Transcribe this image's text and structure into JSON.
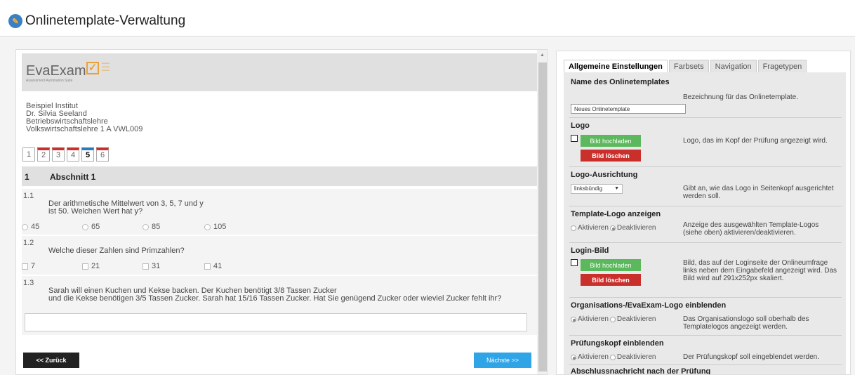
{
  "app": {
    "title": "Onlinetemplate-Verwaltung"
  },
  "preview": {
    "logo": {
      "text": "EvaExam",
      "subtitle": "Assessment Automation Suite"
    },
    "address": [
      "Beispiel Institut",
      "Dr. Silvia Seeland",
      "Betriebswirtschaftslehre",
      "Volkswirtschaftslehre 1 A VWL009"
    ],
    "page_tabs": [
      "1",
      "2",
      "3",
      "4",
      "5",
      "6"
    ],
    "section": {
      "number": "1",
      "title": "Abschnitt 1"
    },
    "questions": [
      {
        "number": "1.1",
        "text": [
          "Der arithmetische Mittelwert von 3, 5, 7 und y",
          "ist 50. Welchen Wert hat y?"
        ],
        "options": [
          "45",
          "65",
          "85",
          "105"
        ]
      },
      {
        "number": "1.2",
        "text": [
          "Welche dieser Zahlen sind Primzahlen?"
        ],
        "options": [
          "7",
          "21",
          "31",
          "41"
        ]
      },
      {
        "number": "1.3",
        "text": [
          "Sarah will einen Kuchen und Kekse backen. Der Kuchen benötigt 3/8 Tassen Zucker",
          "und die Kekse benötigen 3/5 Tassen Zucker. Sarah hat 15/16 Tassen Zucker. Hat Sie genügend Zucker oder wieviel Zucker fehlt ihr?"
        ]
      }
    ],
    "back_label": "<< Zurück",
    "next_label": "Nächste >>"
  },
  "settings": {
    "tabs": [
      "Allgemeine Einstellungen",
      "Farbsets",
      "Navigation",
      "Fragetypen"
    ],
    "name": {
      "heading": "Name des Onlinetemplates",
      "desc": "Bezeichnung für das Onlinetemplate.",
      "value": "Neues Onlinetemplate"
    },
    "logo": {
      "heading": "Logo",
      "upload": "Bild hochladen",
      "delete": "Bild löschen",
      "desc": "Logo, das im Kopf der Prüfung angezeigt wird."
    },
    "logo_align": {
      "heading": "Logo-Ausrichtung",
      "value": "linksbündig",
      "desc": "Gibt an, wie das Logo in Seitenkopf ausgerichtet werden soll."
    },
    "template_logo": {
      "heading": "Template-Logo anzeigen",
      "on": "Aktivieren",
      "off": "Deaktivieren",
      "desc": "Anzeige des ausgewählten Template-Logos (siehe oben) aktivieren/deaktivieren."
    },
    "login_image": {
      "heading": "Login-Bild",
      "upload": "Bild hochladen",
      "delete": "Bild löschen",
      "desc": "Bild, das auf der Loginseite der Onlineumfrage links neben dem Eingabefeld angezeigt wird. Das Bild wird auf 291x252px skaliert."
    },
    "org_logo": {
      "heading": "Organisations-/EvaExam-Logo einblenden",
      "on": "Aktivieren",
      "off": "Deaktivieren",
      "desc": "Das Organisationslogo soll oberhalb des Templatelogos angezeigt werden."
    },
    "exam_header": {
      "heading": "Prüfungskopf einblenden",
      "on": "Aktivieren",
      "off": "Deaktivieren",
      "desc": "Der Prüfungskopf soll eingeblendet werden."
    },
    "final_message": {
      "heading": "Abschlussnachricht nach der Prüfung"
    }
  }
}
